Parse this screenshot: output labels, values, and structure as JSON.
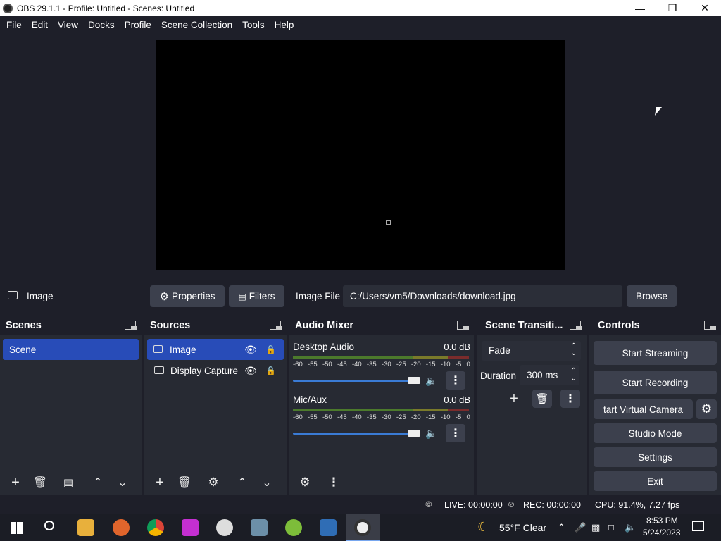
{
  "window": {
    "title": "OBS 29.1.1 - Profile: Untitled - Scenes: Untitled"
  },
  "menu": [
    "File",
    "Edit",
    "View",
    "Docks",
    "Profile",
    "Scene Collection",
    "Tools",
    "Help"
  ],
  "source_toolbar": {
    "source_name": "Image",
    "properties_label": "Properties",
    "filters_label": "Filters",
    "image_file_label": "Image File",
    "image_file_value": "C:/Users/vm5/Downloads/download.jpg",
    "browse_label": "Browse"
  },
  "scenes": {
    "title": "Scenes",
    "items": [
      "Scene"
    ]
  },
  "sources": {
    "title": "Sources",
    "items": [
      "Image",
      "Display Capture"
    ]
  },
  "audio": {
    "title": "Audio Mixer",
    "channels": [
      {
        "name": "Desktop Audio",
        "db": "0.0 dB"
      },
      {
        "name": "Mic/Aux",
        "db": "0.0 dB"
      }
    ],
    "ticks": [
      "-60",
      "-55",
      "-50",
      "-45",
      "-40",
      "-35",
      "-30",
      "-25",
      "-20",
      "-15",
      "-10",
      "-5",
      "0"
    ]
  },
  "transitions": {
    "title": "Scene Transiti...",
    "selected": "Fade",
    "duration_label": "Duration",
    "duration_value": "300 ms"
  },
  "controls": {
    "title": "Controls",
    "start_streaming": "Start Streaming",
    "start_recording": "Start Recording",
    "start_virtual_camera": "tart Virtual Camera",
    "studio_mode": "Studio Mode",
    "settings": "Settings",
    "exit": "Exit"
  },
  "status": {
    "live": "LIVE: 00:00:00",
    "rec": "REC: 00:00:00",
    "cpu": "CPU: 91.4%, 7.27 fps"
  },
  "taskbar": {
    "weather": "55°F  Clear",
    "time": "8:53 PM",
    "date": "5/24/2023"
  }
}
